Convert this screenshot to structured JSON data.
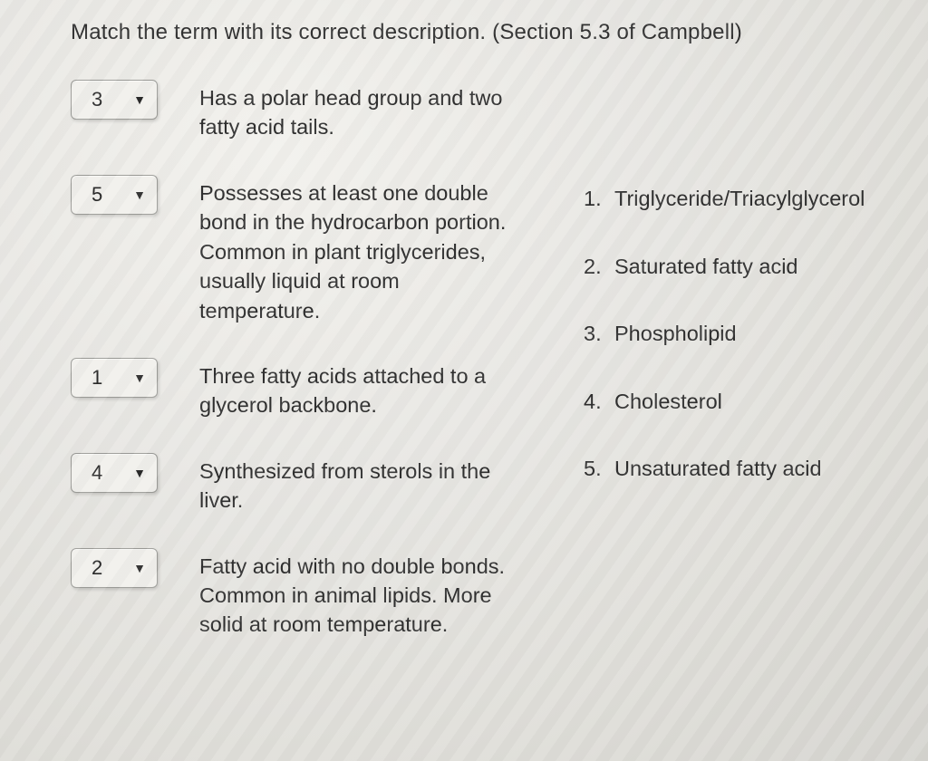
{
  "instruction": "Match the term with its correct description. (Section 5.3 of Campbell)",
  "questions": [
    {
      "selected": "3",
      "description": "Has a polar head group and two fatty acid tails."
    },
    {
      "selected": "5",
      "description": "Possesses at least one double bond in the hydrocarbon portion. Common in plant triglycerides, usually liquid at room temperature."
    },
    {
      "selected": "1",
      "description": "Three fatty acids attached to a glycerol backbone."
    },
    {
      "selected": "4",
      "description": "Synthesized from sterols in the liver."
    },
    {
      "selected": "2",
      "description": "Fatty acid with no double bonds. Common in animal lipids. More solid at room temperature."
    }
  ],
  "terms": [
    {
      "num": "1.",
      "label": "Triglyceride/Triacylglycerol"
    },
    {
      "num": "2.",
      "label": "Saturated fatty acid"
    },
    {
      "num": "3.",
      "label": "Phospholipid"
    },
    {
      "num": "4.",
      "label": "Cholesterol"
    },
    {
      "num": "5.",
      "label": "Unsaturated fatty acid"
    }
  ]
}
